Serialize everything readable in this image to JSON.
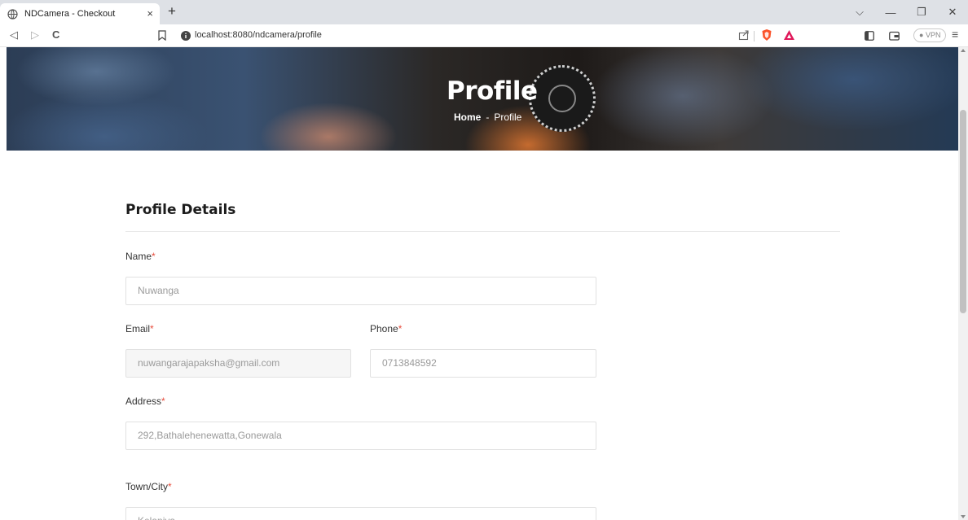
{
  "browser": {
    "tab_title": "NDCamera - Checkout",
    "tab_close": "×",
    "new_tab": "+",
    "url": "localhost:8080/ndcamera/profile",
    "vpn_label": "VPN",
    "nav": {
      "back": "◁",
      "forward": "▷",
      "reload": "C"
    },
    "window": {
      "dropdown": "⌵",
      "minimize": "—",
      "restore": "❐",
      "close": "✕"
    },
    "menu": "≡"
  },
  "hero": {
    "title": "Profile",
    "breadcrumb_home": "Home",
    "breadcrumb_separator": "-",
    "breadcrumb_current": "Profile"
  },
  "form": {
    "section_title": "Profile Details",
    "required_mark": "*",
    "name_label": "Name",
    "name_value": "Nuwanga",
    "email_label": "Email",
    "email_value": "nuwangarajapaksha@gmail.com",
    "phone_label": "Phone",
    "phone_value": "0713848592",
    "address_label": "Address",
    "address_value": "292,Bathalehenewatta,Gonewala",
    "town_label": "Town/City",
    "town_value": "Kelaniya"
  },
  "colors": {
    "required": "#e74c3c",
    "accent_brave": "#fb542b",
    "accent_rewards": "#e0185a"
  }
}
